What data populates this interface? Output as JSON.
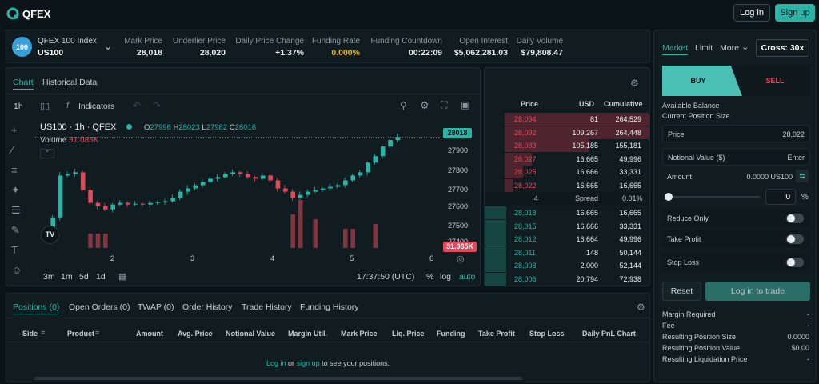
{
  "header": {
    "logo_text": "QFEX",
    "login": "Log in",
    "signup": "Sign up"
  },
  "market": {
    "badge": "100",
    "index_name": "QFEX 100 Index",
    "symbol": "US100",
    "stats": [
      {
        "label": "Mark Price",
        "value": "28,018"
      },
      {
        "label": "Underlier Price",
        "value": "28,020"
      },
      {
        "label": "Daily Price Change",
        "value": "+1.37%"
      },
      {
        "label": "Funding Rate",
        "value": "0.000%"
      },
      {
        "label": "Funding Countdown",
        "value": "00:22:09"
      },
      {
        "label": "Open Interest",
        "value": "$5,062,281.03"
      },
      {
        "label": "Daily Volume",
        "value": "$79,808.47"
      }
    ]
  },
  "chart": {
    "tabs": [
      "Chart",
      "Historical Data"
    ],
    "interval": "1h",
    "indicators": "Indicators",
    "title": "US100 · 1h · QFEX",
    "ohlc": {
      "o_label": "O",
      "o": "27996",
      "h_label": "H",
      "h": "28023",
      "l_label": "L",
      "l": "27982",
      "c_label": "C",
      "c": "28018"
    },
    "volume_label": "Volume",
    "volume_value": "31.085K",
    "price_ticks": [
      "27900",
      "27800",
      "27700",
      "27600",
      "27500",
      "27400"
    ],
    "current_price": "28018",
    "current_volume": "31.085K",
    "x_ticks": [
      "2",
      "3",
      "4",
      "5",
      "6"
    ],
    "ranges": [
      "3m",
      "1m",
      "5d",
      "1d"
    ],
    "time": "17:37:50 (UTC)",
    "scale_opts": [
      "%",
      "log",
      "auto"
    ]
  },
  "orderbook": {
    "headers": [
      "Price",
      "USD",
      "Cumulative"
    ],
    "asks": [
      [
        "28,094",
        "81",
        "264,529"
      ],
      [
        "28,092",
        "109,267",
        "264,448"
      ],
      [
        "28,083",
        "105,185",
        "155,181"
      ],
      [
        "28,027",
        "16,665",
        "49,996"
      ],
      [
        "28,025",
        "16,666",
        "33,331"
      ],
      [
        "28,022",
        "16,665",
        "16,665"
      ]
    ],
    "spread": [
      "4",
      "Spread",
      "0.01%"
    ],
    "bids": [
      [
        "28,018",
        "16,665",
        "16,665"
      ],
      [
        "28,015",
        "16,666",
        "33,331"
      ],
      [
        "28,012",
        "16,664",
        "49,996"
      ],
      [
        "28,011",
        "148",
        "50,144"
      ],
      [
        "28,008",
        "2,000",
        "52,144"
      ],
      [
        "28,006",
        "20,794",
        "72,938"
      ]
    ]
  },
  "bottom": {
    "tabs": [
      "Positions (0)",
      "Open Orders (0)",
      "TWAP (0)",
      "Order History",
      "Trade History",
      "Funding History"
    ],
    "columns": [
      "Side",
      "Product",
      "Amount",
      "Avg. Price",
      "Notional Value",
      "Margin Util.",
      "Mark Price",
      "Liq. Price",
      "Funding",
      "Take Profit",
      "Stop Loss",
      "Daily PnL Chart"
    ],
    "empty_login": "Log in",
    "empty_or": "or",
    "empty_signup": "sign up",
    "empty_rest": "to see your positions."
  },
  "trade": {
    "order_types": [
      "Market",
      "Limit",
      "More"
    ],
    "leverage": "Cross: 30x",
    "buy": "BUY",
    "sell": "SELL",
    "available_balance": "Available Balance",
    "current_position": "Current Position Size",
    "price_label": "Price",
    "price_value": "28,022",
    "notional_label": "Notional Value ($)",
    "notional_placeholder": "Enter",
    "amount_label": "Amount",
    "amount_value": "0.0000 US100",
    "slider_value": "0",
    "slider_unit": "%",
    "reduce_only": "Reduce Only",
    "take_profit": "Take Profit",
    "stop_loss": "Stop Loss",
    "reset": "Reset",
    "login_to_trade": "Log in to trade",
    "summary": [
      {
        "label": "Margin Required",
        "value": "-"
      },
      {
        "label": "Fee",
        "value": "-"
      },
      {
        "label": "Resulting Position Size",
        "value": "0.0000"
      },
      {
        "label": "Resulting Position Value",
        "value": "$0.00"
      },
      {
        "label": "Resulting Liquidation Price",
        "value": "-"
      }
    ]
  },
  "chart_data": {
    "type": "candlestick",
    "y_ticks": [
      27400,
      27500,
      27600,
      27700,
      27800,
      27900
    ],
    "x_ticks": [
      "2",
      "3",
      "4",
      "5",
      "6"
    ],
    "approx_close": [
      27440,
      27520,
      27780,
      27790,
      27800,
      27690,
      27610,
      27590,
      27570,
      27600,
      27610,
      27600,
      27605,
      27600,
      27610,
      27615,
      27620,
      27640,
      27680,
      27700,
      27720,
      27740,
      27760,
      27770,
      27790,
      27800,
      27790,
      27770,
      27760,
      27780,
      27750,
      27700,
      27680,
      27640,
      27660,
      27680,
      27690,
      27700,
      27710,
      27720,
      27750,
      27780,
      27800,
      27860,
      27900,
      27960,
      28000,
      28018
    ],
    "current": 28018
  }
}
